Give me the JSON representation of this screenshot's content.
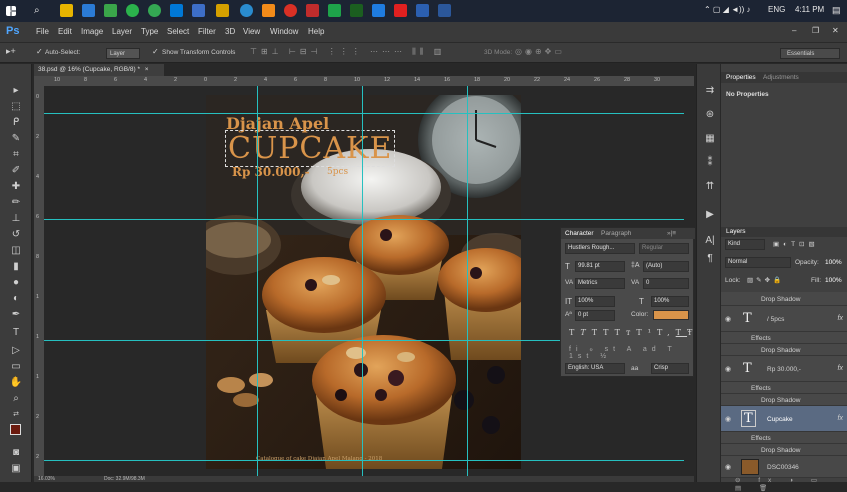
{
  "taskbar": {
    "lang": "ENG",
    "time": "4:11 PM",
    "start_icon": "windows-icon",
    "search_icon": "search-icon"
  },
  "app": {
    "logo": "Ps",
    "menus": [
      "File",
      "Edit",
      "Image",
      "Layer",
      "Type",
      "Select",
      "Filter",
      "3D",
      "View",
      "Window",
      "Help"
    ],
    "window_controls": [
      "–",
      "❐",
      "✕"
    ]
  },
  "options": {
    "auto_select_label": "Auto-Select:",
    "auto_select_value": "Layer",
    "show_transform": "Show Transform Controls",
    "mode_3d": "3D Mode:",
    "workspace": "Essentials"
  },
  "document": {
    "tab_title": "38.psd @ 16% (Cupcake, RGB/8) *",
    "tab_close": "×",
    "status_zoom": "16.03%",
    "status_doc": "Doc: 32.9M/98.3M",
    "brand": "Djajan Apel",
    "product": "CUPCAKE",
    "price": "Rp 30.000,-",
    "pcs": "5pcs",
    "footer": "Catalogue of cake Djajan Apel Malang - 2018"
  },
  "ruler": {
    "h_ticks": [
      "10",
      "8",
      "6",
      "4",
      "2",
      "0",
      "2",
      "4",
      "6",
      "8",
      "10",
      "12",
      "14",
      "16",
      "18",
      "20",
      "22",
      "24",
      "26",
      "28",
      "30"
    ],
    "v_ticks": [
      "0",
      "2",
      "4",
      "6",
      "8",
      "1",
      "1",
      "1",
      "2",
      "2"
    ]
  },
  "properties": {
    "tab_properties": "Properties",
    "tab_adjustments": "Adjustments",
    "empty": "No Properties"
  },
  "character": {
    "tab_character": "Character",
    "tab_paragraph": "Paragraph",
    "font_family": "Hustlers Rough...",
    "font_style": "Regular",
    "font_size": "99.81 pt",
    "leading": "(Auto)",
    "kerning": "Metrics",
    "tracking": "0",
    "vscale": "100%",
    "hscale": "100%",
    "baseline": "0 pt",
    "color_label": "Color:",
    "color_value": "#d9944a",
    "style_buttons": [
      "T",
      "T",
      "TT",
      "Tт",
      "T¹",
      "T,",
      "T",
      "Ŧ"
    ],
    "language": "English: USA",
    "aa_label": "aa",
    "aa_mode": "Crisp"
  },
  "layers": {
    "tab": "Layers",
    "kind": "Kind",
    "blend": "Normal",
    "opacity_label": "Opacity:",
    "opacity": "100%",
    "lock_label": "Lock:",
    "fill_label": "Fill:",
    "fill": "100%",
    "items": [
      {
        "name": "Drop Shadow",
        "type": "effect"
      },
      {
        "name": "/ 5pcs",
        "type": "text",
        "fx": "fx"
      },
      {
        "name": "Effects",
        "type": "effects"
      },
      {
        "name": "Drop Shadow",
        "type": "effect"
      },
      {
        "name": "Rp 30.000,-",
        "type": "text",
        "fx": "fx"
      },
      {
        "name": "Effects",
        "type": "effects"
      },
      {
        "name": "Drop Shadow",
        "type": "effect"
      },
      {
        "name": "Cupcake",
        "type": "text",
        "fx": "fx",
        "selected": true
      },
      {
        "name": "Effects",
        "type": "effects"
      },
      {
        "name": "Drop Shadow",
        "type": "effect"
      },
      {
        "name": "DSC00346",
        "type": "image"
      }
    ]
  },
  "colors": {
    "accent": "#26c0c0",
    "brand_gold": "#d9944a",
    "selected_layer": "#5a6a82"
  }
}
